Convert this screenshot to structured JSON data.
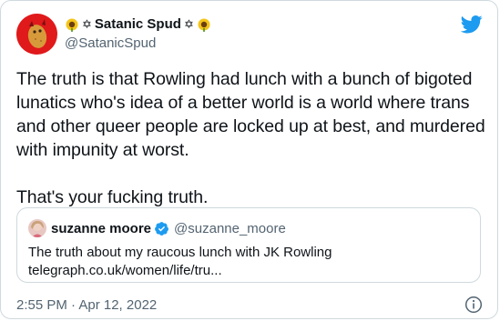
{
  "author": {
    "display_name": "Satanic Spud",
    "handle": "@SatanicSpud"
  },
  "tweet": {
    "text": "The truth is that Rowling had lunch with a bunch of bigoted lunatics who's idea of a better world is a world where trans and other queer people are locked up at best, and murdered with impunity at worst.\n\nThat's your fucking truth.",
    "timestamp": "2:55 PM · Apr 12, 2022"
  },
  "quoted": {
    "display_name": "suzanne moore",
    "handle": "@suzanne_moore",
    "text": "The truth about my raucous lunch with JK Rowling",
    "link": "telegraph.co.uk/women/life/tru..."
  },
  "icons": {
    "brand": "twitter-bird-icon",
    "info": "info-icon",
    "verified": "verified-badge-icon",
    "sunflower": "sunflower-emoji",
    "star": "pentagram-star-icon"
  },
  "colors": {
    "brand_blue": "#1d9bf0",
    "avatar_red": "#e0191b",
    "text_primary": "#0f1419",
    "text_secondary": "#536471",
    "border": "#cfd9de"
  }
}
